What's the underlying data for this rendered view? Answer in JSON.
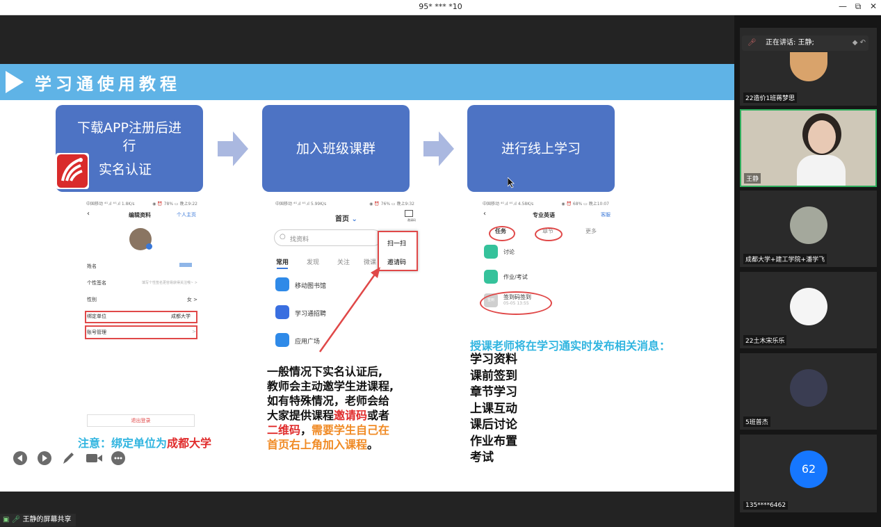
{
  "window": {
    "title": "95* *** *10",
    "min_icon": "—",
    "restore_icon": "⧉",
    "close_icon": "✕"
  },
  "slide": {
    "title": "学习通使用教程",
    "steps": [
      {
        "line1": "下载APP注册后进",
        "line2": "行",
        "line3": "实名认证"
      },
      {
        "label": "加入班级课群"
      },
      {
        "label": "进行线上学习"
      }
    ],
    "phone1": {
      "status_left": "中国移动 ⁴ᴳ.ıl ⁴ᴳ.ıl 1.8K/s",
      "status_right": "◉ ⏰ 78% ▭ 晚上9:22",
      "header": "编辑资料",
      "header_link": "个人主页",
      "rows": [
        {
          "label": "姓名",
          "value": ""
        },
        {
          "label": "个性签名",
          "value": "填写个性签名更容易获得关注哦~  >"
        },
        {
          "label": "性别",
          "value": "女  >"
        },
        {
          "label": "绑定单位",
          "value": "成都大学"
        },
        {
          "label": "账号管理",
          "value": ">"
        }
      ],
      "logout": "退出登录",
      "note_prefix": "注意：绑定单位为",
      "note_highlight": "成都大学"
    },
    "phone2": {
      "status_left": "中国移动 ⁴ᴳ.ıl ⁴ᴳ.ıl 5.99K/s",
      "status_right": "◉ ⏰ 76% ▭ 晚上9:32",
      "header": "首页",
      "scan_label": "邀请码",
      "search_placeholder": "找资料",
      "tabs": [
        "常用",
        "发现",
        "关注",
        "微课"
      ],
      "menu": [
        "扫一扫",
        "邀请码"
      ],
      "items": [
        "移动图书馆",
        "学习通招聘",
        "应用广场"
      ],
      "desc_1": "一般情况下实名认证后,",
      "desc_2": "教师会主动邀学生进课程,",
      "desc_3": "如有特殊情况，老师会给",
      "desc_4a": "大家提供课程",
      "desc_4b": "邀请码",
      "desc_4c": "或者",
      "desc_5a": "二维码",
      "desc_5b": "，",
      "desc_5c": "需要学生自己在",
      "desc_6a": "首页右上角加入课程",
      "desc_6b": "。"
    },
    "phone3": {
      "status_left": "中国移动 ⁴ᴳ.ıl ⁴ᴳ.ıl 4.58K/s",
      "status_right": "◉ ⏰ 68% ▭ 晚上10:07",
      "header": "专业英语",
      "header_link": "客服",
      "tabs": [
        "任务",
        "章节",
        "更多"
      ],
      "items": [
        "讨论",
        "作业/考试"
      ],
      "signin_title": "签到码签到",
      "signin_time": "05-05 13:55",
      "signin_icon": "签到",
      "headline": "授课老师将在学习通实时发布相关消息：",
      "list": [
        "学习资料",
        "课前签到",
        "章节学习",
        "上课互动",
        "课后讨论",
        "作业布置",
        "考试"
      ]
    }
  },
  "share_label": "王静的屏幕共享",
  "participants": {
    "speaking_prefix": "正在讲话: 王静;",
    "tiles": [
      {
        "name": "22造价1班蒋梦思"
      },
      {
        "name": "王静"
      },
      {
        "name": "成都大学+建工学院+潘学飞"
      },
      {
        "name": "22土木宋乐乐"
      },
      {
        "name": "5班普杰"
      },
      {
        "name": "135****6462",
        "avatar_text": "62"
      }
    ]
  }
}
